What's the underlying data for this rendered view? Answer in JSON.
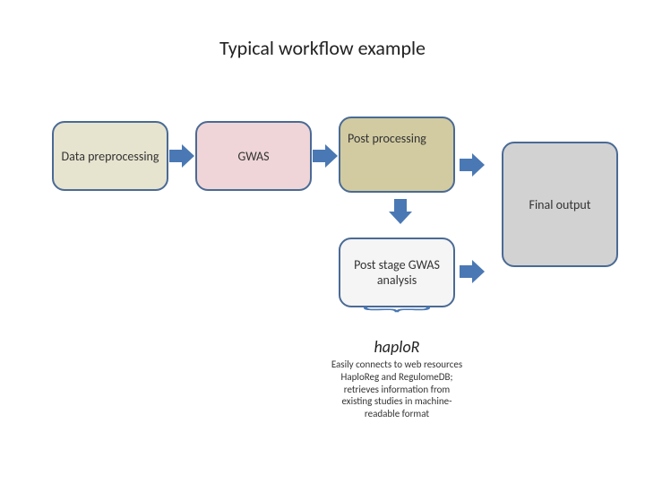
{
  "title": "Typical workflow example",
  "boxes": {
    "preprocessing": "Data preprocessing",
    "gwas": "GWAS",
    "postprocessing": "Post processing",
    "poststage": "Post stage GWAS analysis",
    "final": "Final output"
  },
  "tool": {
    "name": "haploR",
    "description": "Easily connects to web resources HaploReg and RegulomeDB; retrieves information from existing studies in machine-readable format"
  }
}
